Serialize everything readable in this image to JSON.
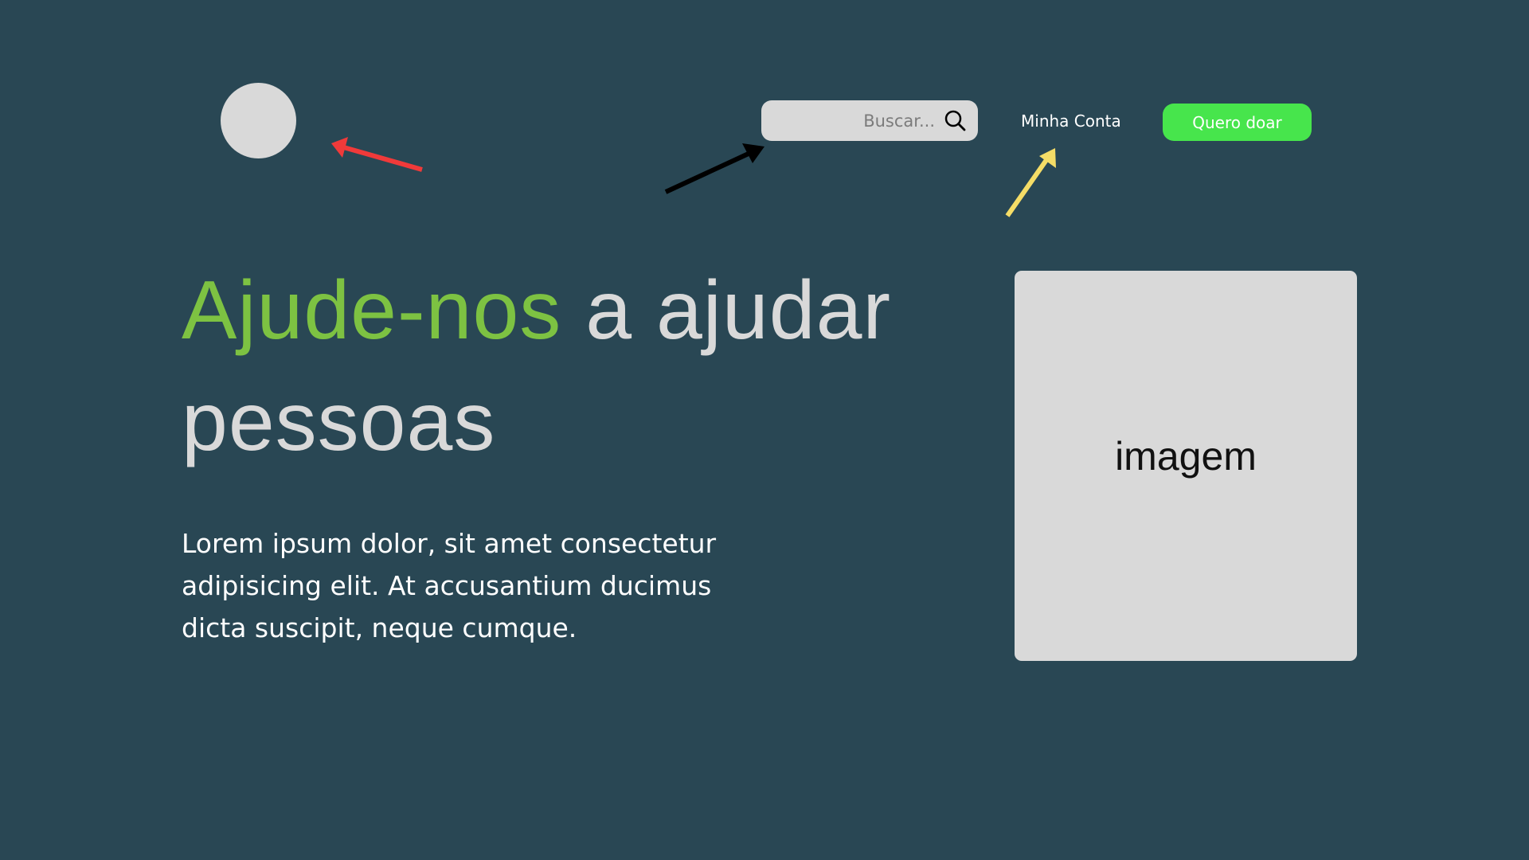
{
  "header": {
    "search_placeholder": "Buscar...",
    "search_icon": "search-icon",
    "account_link": "Minha Conta",
    "donate_button": "Quero doar"
  },
  "hero": {
    "title_accent": "Ajude-nos",
    "title_rest": " a ajudar pessoas",
    "body": "Lorem ipsum dolor, sit amet consectetur adipisicing elit. At accusantium ducimus dicta suscipit, neque cumque."
  },
  "image_placeholder": {
    "label": "imagem"
  },
  "colors": {
    "background": "#294754",
    "accent_green": "#7dc242",
    "button_green": "#47e54c",
    "placeholder_gray": "#d9d9d9",
    "arrow_red": "#f03a3a",
    "arrow_black": "#000000",
    "arrow_yellow": "#f5dd67"
  }
}
